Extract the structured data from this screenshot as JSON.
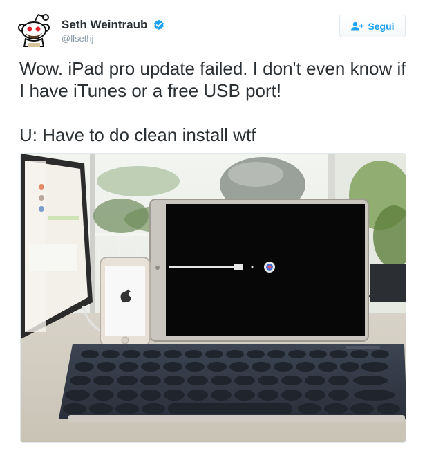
{
  "tweet": {
    "author": {
      "display_name": "Seth Weintraub",
      "handle": "@llsethj",
      "verified": true
    },
    "follow_button": {
      "label": "Segui",
      "icon": "add-user-icon"
    },
    "text": {
      "line1": "Wow. iPad pro update failed. I don't even know if I have iTunes or a free USB port!",
      "line2": "U: Have to do clean install wtf"
    },
    "media": {
      "type": "photo"
    }
  },
  "colors": {
    "accent": "#1da1f2",
    "text": "#292f33",
    "muted": "#8899a6",
    "border": "#e1e8ed"
  }
}
